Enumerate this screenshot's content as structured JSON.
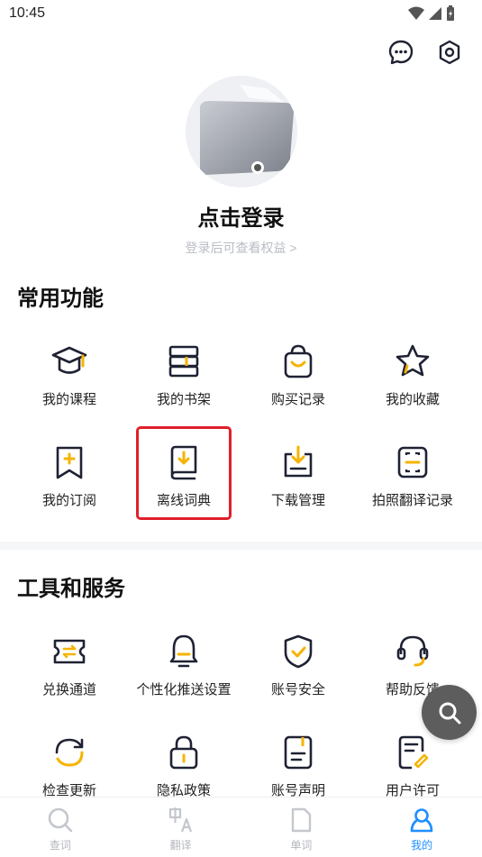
{
  "status_bar": {
    "time": "10:45"
  },
  "profile": {
    "login_title": "点击登录",
    "login_subtitle": "登录后可查看权益 >"
  },
  "sections": {
    "common": {
      "title": "常用功能",
      "items": [
        {
          "label": "我的课程",
          "icon": "graduation-cap-icon"
        },
        {
          "label": "我的书架",
          "icon": "bookshelf-icon"
        },
        {
          "label": "购买记录",
          "icon": "shopping-bag-icon"
        },
        {
          "label": "我的收藏",
          "icon": "star-icon"
        },
        {
          "label": "我的订阅",
          "icon": "bookmark-add-icon"
        },
        {
          "label": "离线词典",
          "icon": "offline-dictionary-icon"
        },
        {
          "label": "下载管理",
          "icon": "download-tray-icon"
        },
        {
          "label": "拍照翻译记录",
          "icon": "scan-frame-icon"
        }
      ]
    },
    "tools": {
      "title": "工具和服务",
      "items": [
        {
          "label": "兑换通道",
          "icon": "ticket-exchange-icon"
        },
        {
          "label": "个性化推送设置",
          "icon": "bell-icon"
        },
        {
          "label": "账号安全",
          "icon": "shield-check-icon"
        },
        {
          "label": "帮助反馈",
          "icon": "headset-icon"
        },
        {
          "label": "检查更新",
          "icon": "refresh-icon"
        },
        {
          "label": "隐私政策",
          "icon": "lock-icon"
        },
        {
          "label": "账号声明",
          "icon": "document-icon"
        },
        {
          "label": "用户许可",
          "icon": "license-icon"
        }
      ]
    }
  },
  "bottom_nav": [
    {
      "label": "查词",
      "icon": "search-icon",
      "active": false
    },
    {
      "label": "翻译",
      "icon": "translate-icon",
      "active": false
    },
    {
      "label": "单词",
      "icon": "word-card-icon",
      "active": false
    },
    {
      "label": "我的",
      "icon": "profile-icon",
      "active": true
    }
  ],
  "colors": {
    "accent": "#f5b400",
    "icon_stroke": "#1f2233",
    "active_tab": "#1e8fff",
    "highlight_border": "#e0202a"
  }
}
